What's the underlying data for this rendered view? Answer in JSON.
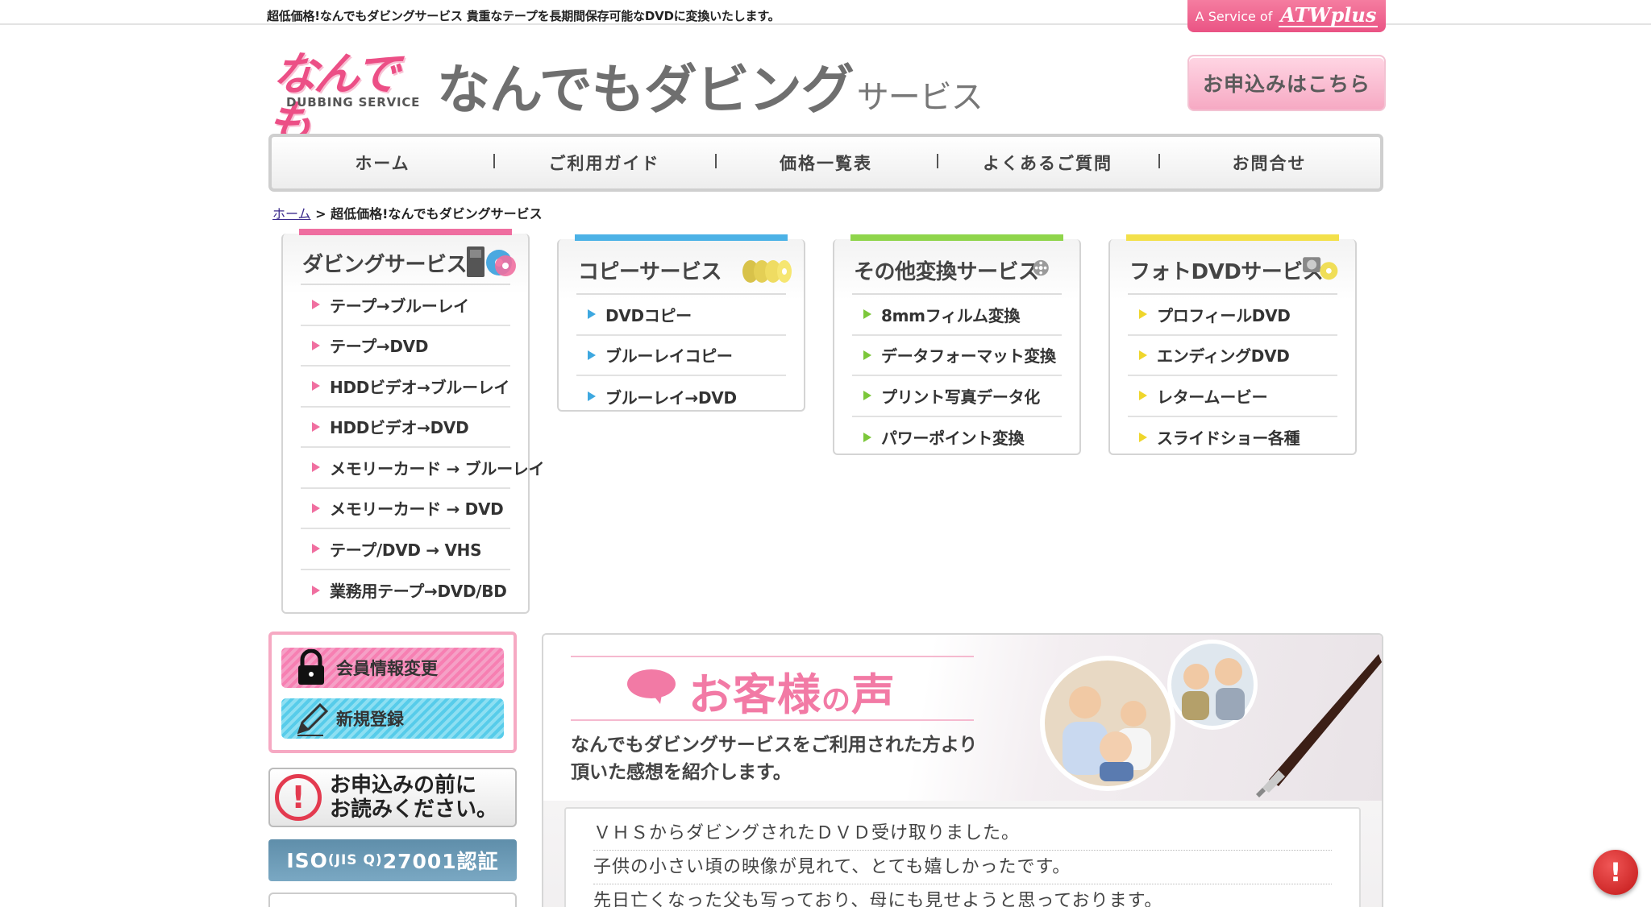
{
  "topbar": {
    "tagline": "超低価格!なんでもダビングサービス 貴重なテープを長期間保存可能なDVDに変換いたします。",
    "service_badge": {
      "prefix": "A Service of",
      "brand": "ATWplus"
    }
  },
  "header": {
    "logo_jp": "なんでも",
    "logo_en": "DUBBING SERVICE",
    "title_main": "なんでもダビング",
    "title_sub": "サービス",
    "apply_button": "お申込みはこちら"
  },
  "nav": [
    "ホーム",
    "ご利用ガイド",
    "価格一覧表",
    "よくあるご質問",
    "お問合せ"
  ],
  "breadcrumb": {
    "home": "ホーム",
    "separator": ">",
    "current": "超低価格!なんでもダビングサービス"
  },
  "cards": [
    {
      "title": "ダビングサービス",
      "accent": "#ef6ea0",
      "bullet": "#f06fa0",
      "items": [
        "テープ→ブルーレイ",
        "テープ→DVD",
        "HDDビデオ→ブルーレイ",
        "HDDビデオ→DVD",
        "メモリーカード → ブルーレイ",
        "メモリーカード → DVD",
        "テープ/DVD → VHS",
        "業務用テープ→DVD/BD"
      ]
    },
    {
      "title": "コピーサービス",
      "accent": "#4cb2e6",
      "bullet": "#3ea8e0",
      "items": [
        "DVDコピー",
        "ブルーレイコピー",
        "ブルーレイ→DVD"
      ]
    },
    {
      "title": "その他変換サービス",
      "accent": "#8fd54b",
      "bullet": "#7cc73a",
      "items": [
        "8mmフィルム変換",
        "データフォーマット変換",
        "プリント写真データ化",
        "パワーポイント変換"
      ]
    },
    {
      "title": "フォトDVDサービス",
      "accent": "#f3e04a",
      "bullet": "#efd62c",
      "items": [
        "プロフィールDVD",
        "エンディングDVD",
        "レタームービー",
        "スライドショー各種"
      ]
    }
  ],
  "sidebar": {
    "member_edit": "会員情報変更",
    "register": "新規登録",
    "notice_line1": "お申込みの前に",
    "notice_line2": "お読みください。",
    "iso_main": "ISO",
    "iso_small": "(JIS Q)",
    "iso_code": "27001認証"
  },
  "voice": {
    "title_main": "お客様",
    "title_no": "の",
    "title_end": "声",
    "lead_line1": "なんでもダビングサービスをご利用された方より",
    "lead_line2": "頂いた感想を紹介します。",
    "testimonial": [
      "ＶＨＳからダビングされたＤＶＤ受け取りました。",
      "子供の小さい頃の映像が見れて、とても嬉しかったです。",
      "先日亡くなった父も写っており、母にも見せようと思っております。"
    ]
  },
  "colors": {
    "brand_pink": "#ec4f86",
    "nav_border": "#cfcfcf",
    "alert_red": "#e33a4f"
  },
  "icons": {
    "floating_alert": "exclamation-icon"
  }
}
